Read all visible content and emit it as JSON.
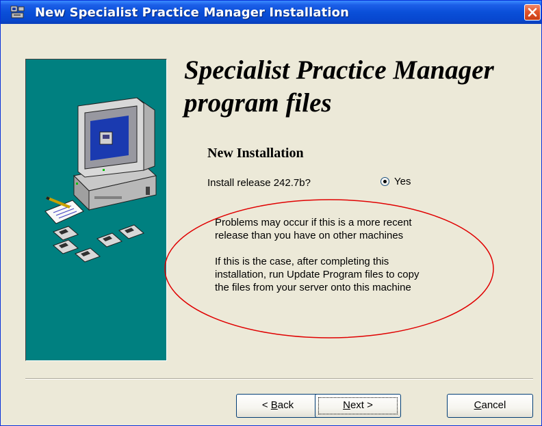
{
  "window": {
    "title": "New Specialist Practice Manager Installation",
    "title_icon": "installer-icon",
    "close_icon": "close-icon"
  },
  "side_panel": {
    "illustration": [
      "computer-monitor-icon",
      "document-pen-icon",
      "floppy-disk-icon"
    ],
    "background_color": "#008080"
  },
  "content": {
    "heading_line1": "Specialist Practice Manager",
    "heading_line2": "program files",
    "section_title": "New Installation",
    "install_question": "Install release 242.7b?",
    "option_yes": "Yes",
    "option_yes_selected": true,
    "message_line1": "Problems may occur if this is a more recent",
    "message_line2": "release than you have on other machines",
    "message_line3": "If this is the case, after completing this",
    "message_line4": "installation, run Update Program files to copy",
    "message_line5": "the files from your server onto this machine",
    "annotation_color": "#e00000"
  },
  "buttons": {
    "back_prefix": "< ",
    "back_mnemonic": "B",
    "back_rest": "ack",
    "next_mnemonic": "N",
    "next_rest": "ext >",
    "cancel_mnemonic": "C",
    "cancel_rest": "ancel"
  }
}
